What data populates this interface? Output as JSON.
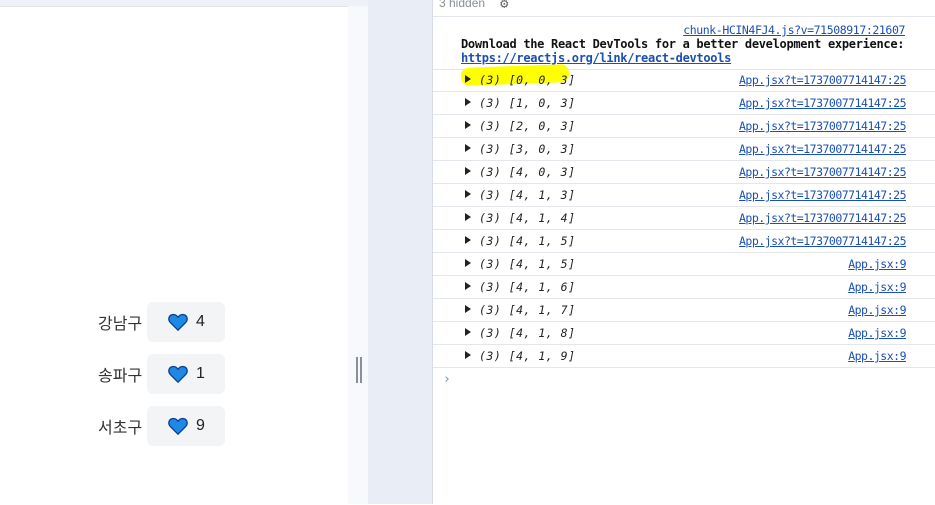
{
  "app": {
    "districts": [
      {
        "name": "강남구",
        "count": "4"
      },
      {
        "name": "송파구",
        "count": "1"
      },
      {
        "name": "서초구",
        "count": "9"
      }
    ],
    "heart_color": "#1e88e5"
  },
  "console": {
    "hidden_label": "3 hidden",
    "devtools_msg": {
      "source": "chunk-HCIN4FJ4.js?v=71508917:21607",
      "text": "Download the React DevTools for a better development experience:",
      "link": "https://reactjs.org/link/react-devtools"
    },
    "logs": [
      {
        "value": "(3) [0, 0, 3]",
        "source": "App.jsx?t=1737007714147:25"
      },
      {
        "value": "(3) [1, 0, 3]",
        "source": "App.jsx?t=1737007714147:25"
      },
      {
        "value": "(3) [2, 0, 3]",
        "source": "App.jsx?t=1737007714147:25"
      },
      {
        "value": "(3) [3, 0, 3]",
        "source": "App.jsx?t=1737007714147:25"
      },
      {
        "value": "(3) [4, 0, 3]",
        "source": "App.jsx?t=1737007714147:25"
      },
      {
        "value": "(3) [4, 1, 3]",
        "source": "App.jsx?t=1737007714147:25"
      },
      {
        "value": "(3) [4, 1, 4]",
        "source": "App.jsx?t=1737007714147:25"
      },
      {
        "value": "(3) [4, 1, 5]",
        "source": "App.jsx?t=1737007714147:25"
      },
      {
        "value": "(3) [4, 1, 5]",
        "source": "App.jsx:9"
      },
      {
        "value": "(3) [4, 1, 6]",
        "source": "App.jsx:9"
      },
      {
        "value": "(3) [4, 1, 7]",
        "source": "App.jsx:9"
      },
      {
        "value": "(3) [4, 1, 8]",
        "source": "App.jsx:9"
      },
      {
        "value": "(3) [4, 1, 9]",
        "source": "App.jsx:9"
      }
    ],
    "highlight_color": "#ffff00"
  }
}
